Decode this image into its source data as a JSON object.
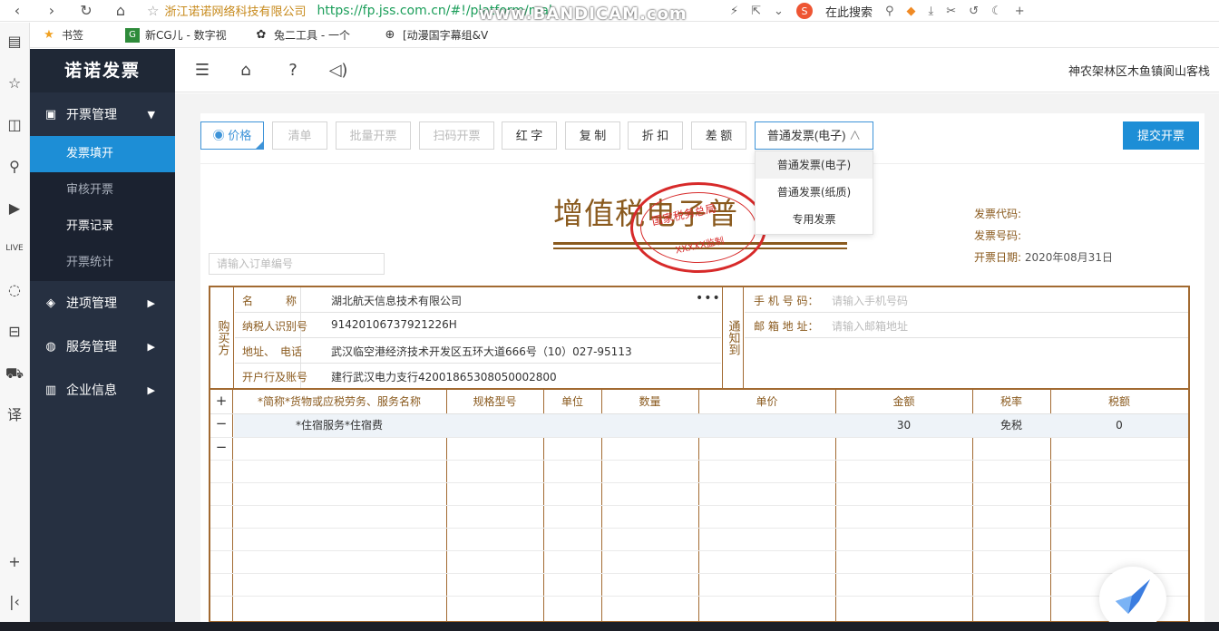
{
  "browser": {
    "site_name": "浙江诺诺网络科技有限公司",
    "url": "https://fp.jss.com.cn/#!/platform/make",
    "watermark": "www.BANDICAM.com",
    "search_label": "在此搜索",
    "bookmarks": [
      {
        "label": "书签",
        "icon": "star-icon"
      },
      {
        "label": "新CG儿 - 数字视",
        "icon": "cg-icon"
      },
      {
        "label": "兔二工具 - 一个",
        "icon": "rabbit-icon"
      },
      {
        "label": "[动漫国字幕组&V",
        "icon": "globe-icon"
      }
    ]
  },
  "app": {
    "logo": "诺诺发票",
    "company": "神农架林区木鱼镇阆山客栈"
  },
  "sidebar": {
    "groups": [
      {
        "label": "开票管理",
        "icon": "invoice-icon",
        "expanded": true
      },
      {
        "label": "进项管理",
        "icon": "layers-icon",
        "expanded": false
      },
      {
        "label": "服务管理",
        "icon": "globe-icon",
        "expanded": false
      },
      {
        "label": "企业信息",
        "icon": "building-icon",
        "expanded": false
      }
    ],
    "sub_items": [
      {
        "label": "发票填开",
        "active": true
      },
      {
        "label": "审核开票",
        "active": false
      },
      {
        "label": "开票记录",
        "active": false
      },
      {
        "label": "开票统计",
        "active": false
      }
    ]
  },
  "actions": {
    "price": "价格",
    "list": "清单",
    "batch": "批量开票",
    "scan": "扫码开票",
    "red": "红 字",
    "copy": "复 制",
    "discount": "折 扣",
    "diff": "差 额",
    "type_selected": "普通发票(电子)",
    "submit": "提交开票"
  },
  "type_options": [
    "普通发票(电子)",
    "普通发票(纸质)",
    "专用发票"
  ],
  "invoice": {
    "title": "增值税电子普",
    "stamp_text": "国家税务总局",
    "stamp_sub": "样 章",
    "stamp_code": "XXXXX监制",
    "code_label": "发票代码:",
    "number_label": "发票号码:",
    "date_label": "开票日期:",
    "date_value": "2020年08月31日",
    "order_placeholder": "请输入订单编号"
  },
  "buyer": {
    "label": "购买方",
    "rows": [
      {
        "key": "名　　　称",
        "value": "湖北航天信息技术有限公司"
      },
      {
        "key": "纳税人识别号",
        "value": "91420106737921226H"
      },
      {
        "key": "地址、　电话",
        "value": "武汉临空港经济技术开发区五环大道666号（10）027-95113"
      },
      {
        "key": "开户行及账号",
        "value": "建行武汉电力支行42001865308050002800"
      }
    ],
    "more": "•••"
  },
  "notify": {
    "label": "通知到",
    "phone_label": "手 机 号 码：",
    "phone_placeholder": "请输入手机号码",
    "email_label": "邮 箱 地 址：",
    "email_placeholder": "请输入邮箱地址"
  },
  "items": {
    "headers": [
      "*简称*货物或应税劳务、服务名称",
      "规格型号",
      "单位",
      "数量",
      "单价",
      "金额",
      "税率",
      "税额"
    ],
    "rows": [
      {
        "name": "*住宿服务*住宿费",
        "spec": "",
        "unit": "",
        "qty": "",
        "price": "",
        "amount": "30",
        "rate": "免税",
        "tax": "0"
      }
    ],
    "add": "+",
    "remove": "−"
  }
}
